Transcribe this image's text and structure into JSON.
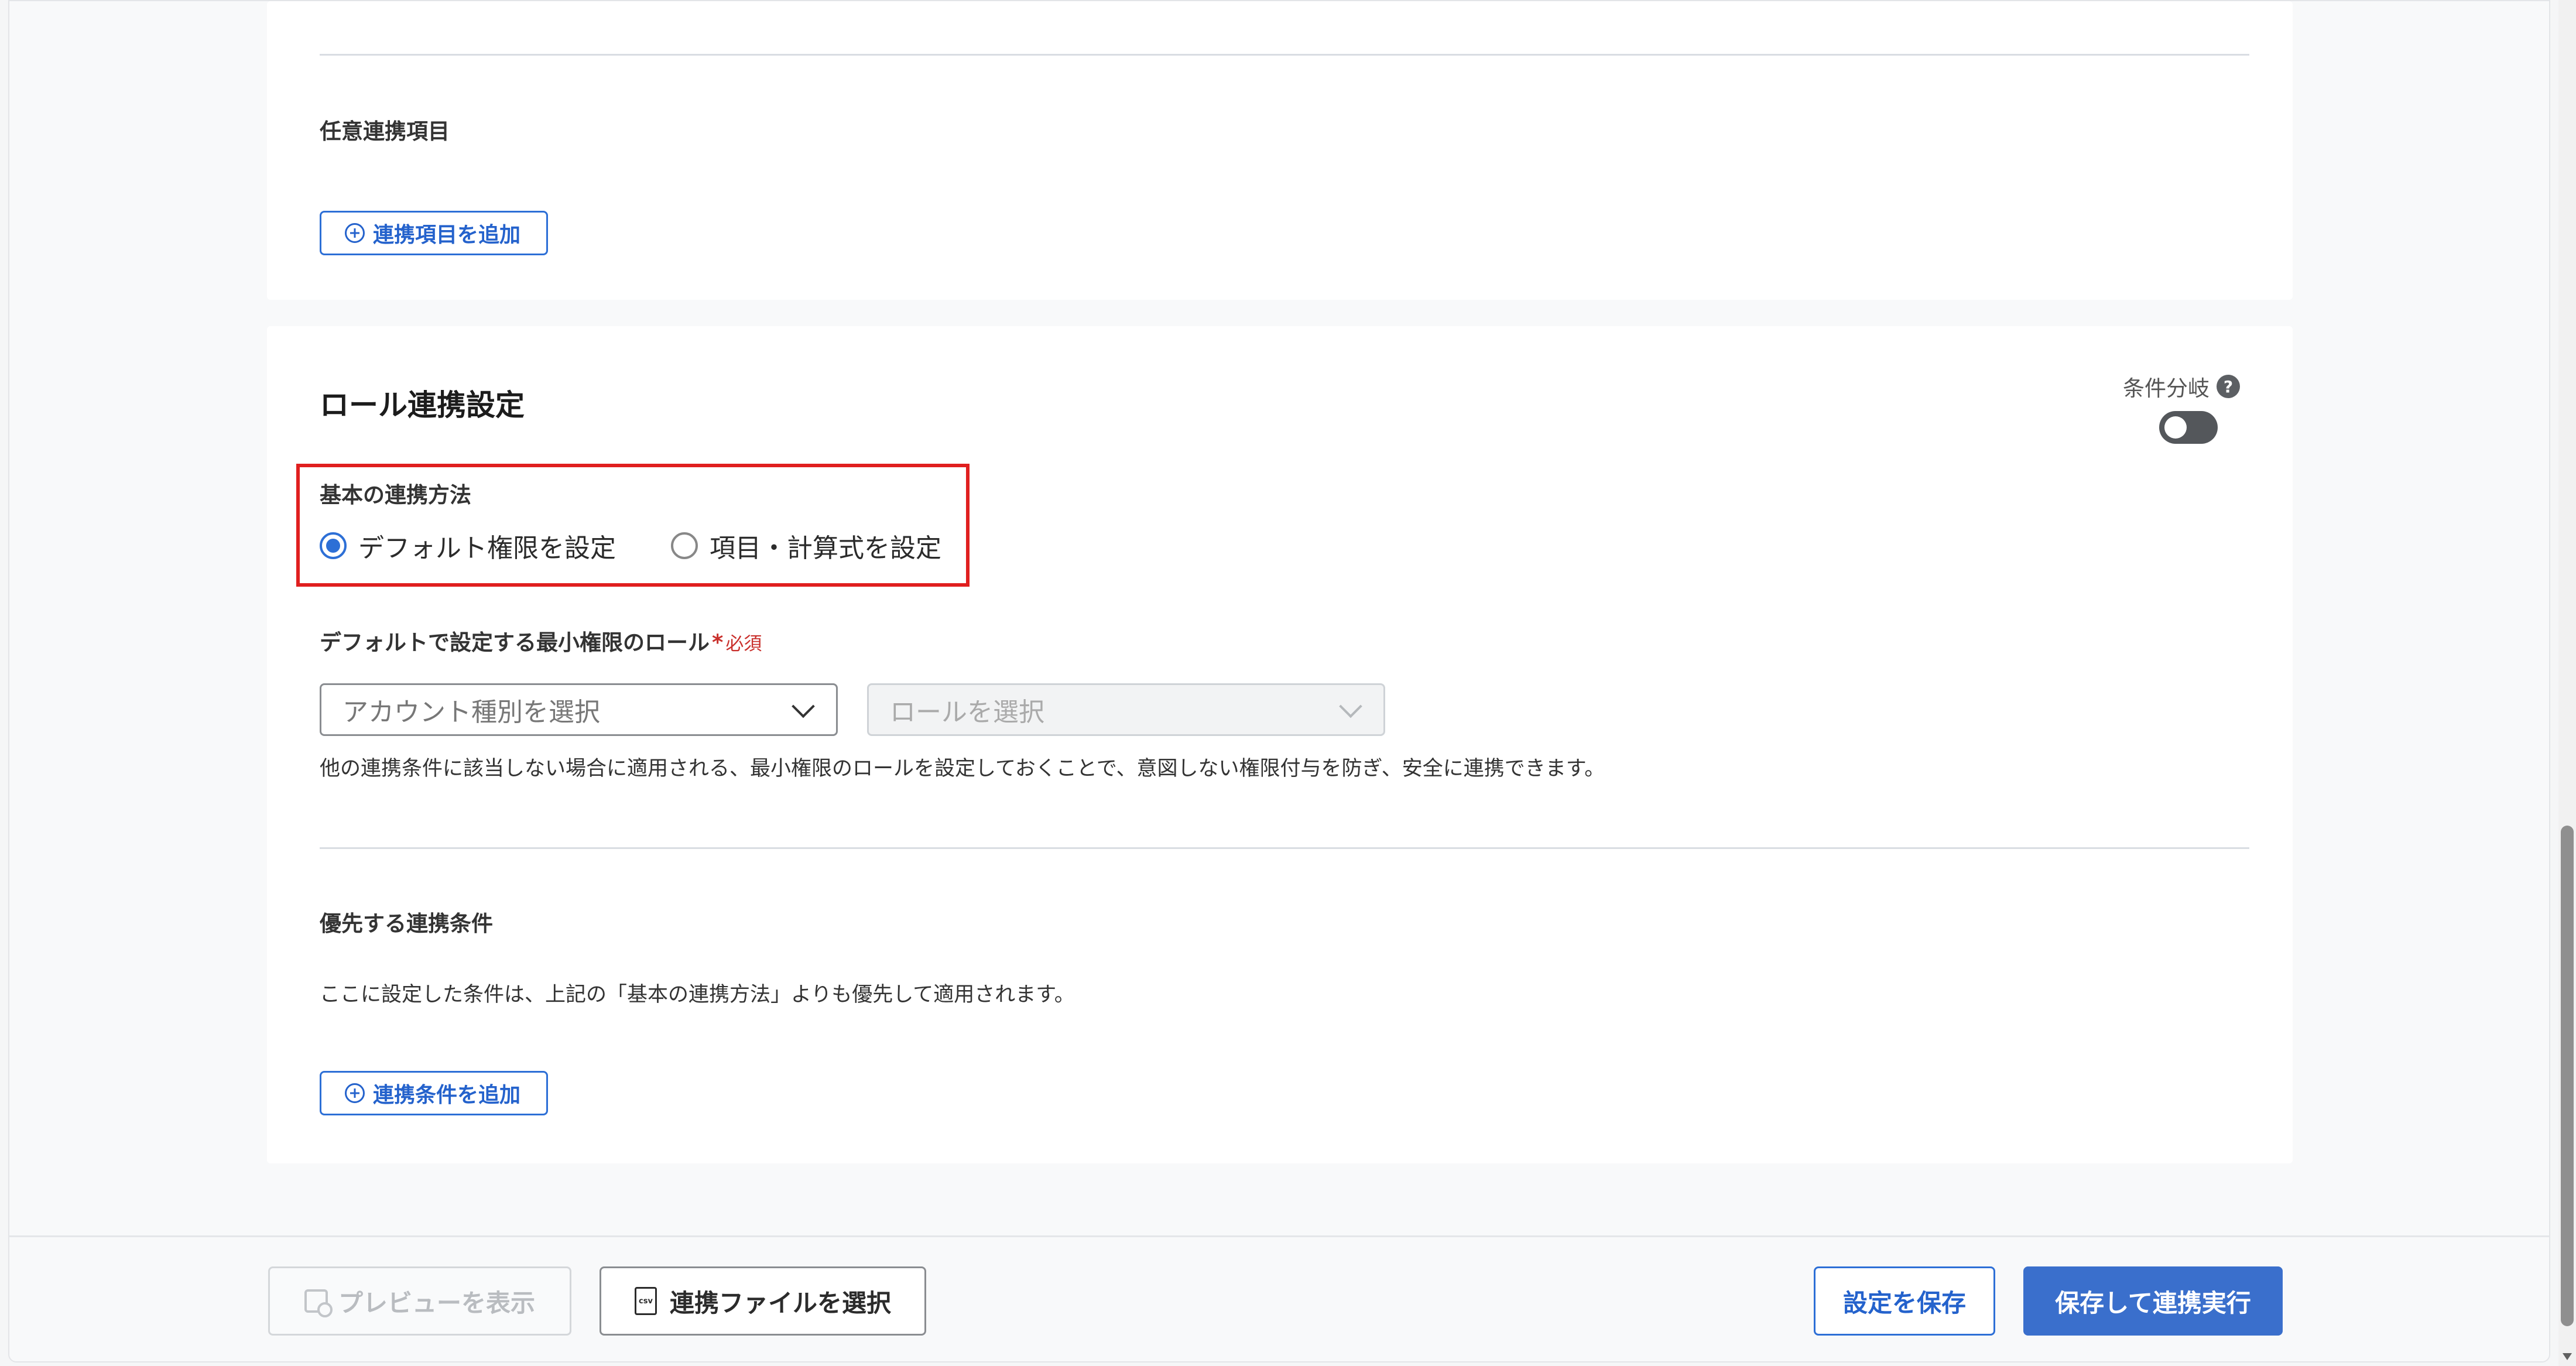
{
  "section1": {
    "optional_items_label": "任意連携項目",
    "add_item_button": "連携項目を追加"
  },
  "role": {
    "title": "ロール連携設定",
    "conditional_branch_label": "条件分岐",
    "help_glyph": "?",
    "toggle_on": false,
    "basic_method_label": "基本の連携方法",
    "radio_default": "デフォルト権限を設定",
    "radio_formula": "項目・計算式を設定",
    "selected_method": "default",
    "min_role_label": "デフォルトで設定する最小権限のロール",
    "required_star": "*",
    "required_badge": "必須",
    "account_type_placeholder": "アカウント種別を選択",
    "role_placeholder": "ロールを選択",
    "min_role_help": "他の連携条件に該当しない場合に適用される、最小権限のロールを設定しておくことで、意図しない権限付与を防ぎ、安全に連携できます。",
    "priority_label": "優先する連携条件",
    "priority_help": "ここに設定した条件は、上記の「基本の連携方法」よりも優先して適用されます。",
    "add_condition_button": "連携条件を追加"
  },
  "footer": {
    "preview_button": "プレビューを表示",
    "select_file_button": "連携ファイルを選択",
    "csv_icon_text": "csv",
    "save_button": "設定を保存",
    "save_run_button": "保存して連携実行"
  },
  "colors": {
    "accent": "#2d6fd6",
    "primary_button": "#3a6fcc",
    "highlight_border": "#e01f1f",
    "required": "#c9302c"
  }
}
